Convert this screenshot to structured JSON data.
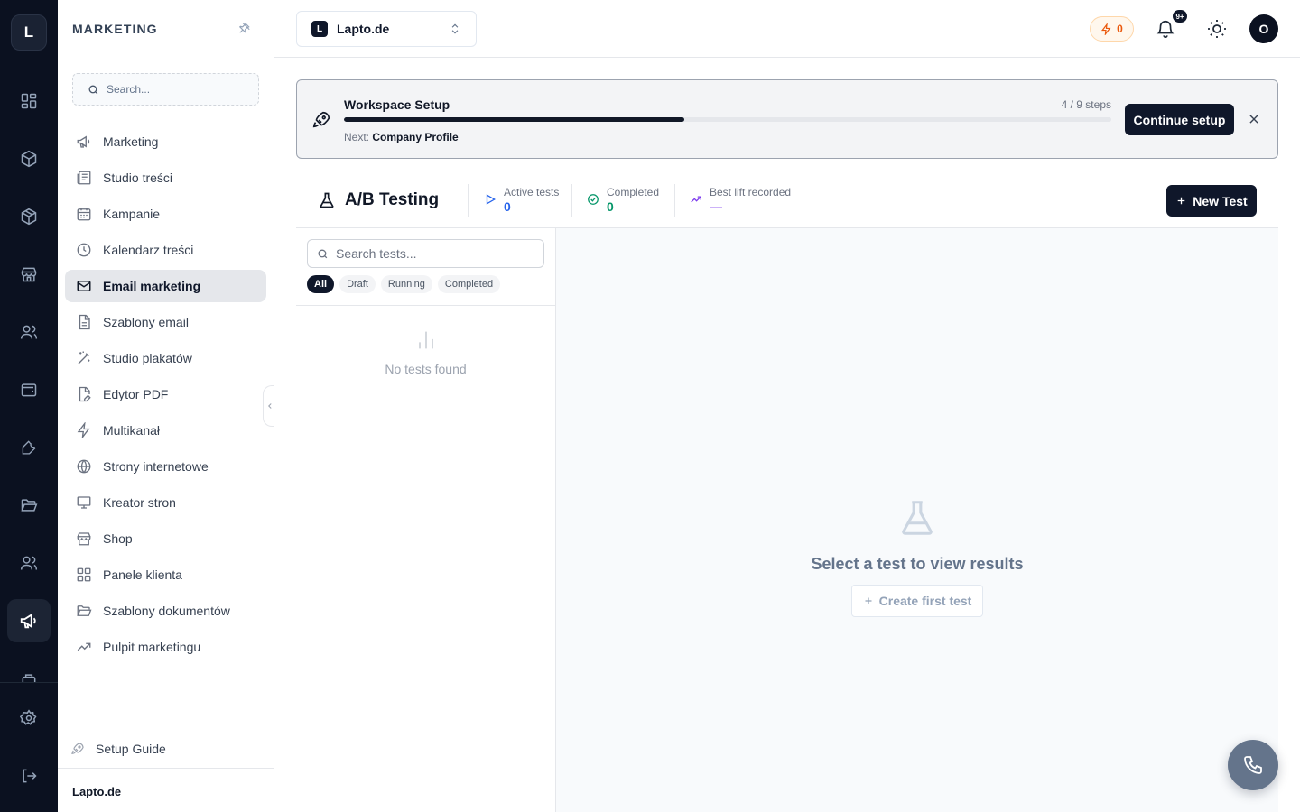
{
  "rail": {
    "logo": "L",
    "items": [
      {
        "icon": "layout-grid-icon"
      },
      {
        "icon": "box-icon"
      },
      {
        "icon": "package-icon"
      },
      {
        "icon": "store-icon"
      },
      {
        "icon": "users-icon"
      },
      {
        "icon": "wallet-icon"
      },
      {
        "icon": "wrench-icon"
      },
      {
        "icon": "folder-open-icon"
      },
      {
        "icon": "user-group-icon"
      },
      {
        "icon": "megaphone-icon",
        "active": true
      }
    ],
    "bottom": [
      {
        "icon": "gear-icon"
      },
      {
        "icon": "logout-icon"
      }
    ]
  },
  "sidebar": {
    "title": "MARKETING",
    "search_placeholder": "Search...",
    "items": [
      {
        "label": "Marketing",
        "icon": "megaphone-icon"
      },
      {
        "label": "Studio treści",
        "icon": "newspaper-icon"
      },
      {
        "label": "Kampanie",
        "icon": "calendar-icon"
      },
      {
        "label": "Kalendarz treści",
        "icon": "clock-icon"
      },
      {
        "label": "Email marketing",
        "icon": "mail-icon",
        "active": true
      },
      {
        "label": "Szablony email",
        "icon": "file-text-icon"
      },
      {
        "label": "Studio plakatów",
        "icon": "wand-icon"
      },
      {
        "label": "Edytor PDF",
        "icon": "file-pen-icon"
      },
      {
        "label": "Multikanał",
        "icon": "zap-icon"
      },
      {
        "label": "Strony internetowe",
        "icon": "globe-icon"
      },
      {
        "label": "Kreator stron",
        "icon": "monitor-icon"
      },
      {
        "label": "Shop",
        "icon": "store-icon"
      },
      {
        "label": "Panele klienta",
        "icon": "layout-grid-icon"
      },
      {
        "label": "Szablony dokumentów",
        "icon": "folder-icon"
      },
      {
        "label": "Pulpit marketingu",
        "icon": "trending-up-icon"
      }
    ],
    "setup_guide": "Setup Guide",
    "footer_name": "Lapto.de"
  },
  "header": {
    "workspace_badge": "L",
    "workspace_name": "Lapto.de",
    "credits": "0",
    "notifications_badge": "9+",
    "avatar": "O"
  },
  "setup_banner": {
    "title": "Workspace Setup",
    "steps_text": "4 / 9 steps",
    "progress": 0.444,
    "next_label": "Next:",
    "next_value": "Company Profile",
    "button": "Continue setup"
  },
  "ab": {
    "title": "A/B Testing",
    "stats": [
      {
        "label": "Active tests",
        "value": "0",
        "color": "#2563eb",
        "icon": "play-icon"
      },
      {
        "label": "Completed",
        "value": "0",
        "color": "#059669",
        "icon": "check-circle-icon"
      },
      {
        "label": "Best lift recorded",
        "value": "—",
        "color": "#7c3aed",
        "icon": "trending-up-icon"
      }
    ],
    "new_button": "New Test",
    "search_placeholder": "Search tests...",
    "filters": [
      "All",
      "Draft",
      "Running",
      "Completed"
    ],
    "active_filter": "All",
    "empty_list": "No tests found",
    "detail_empty": "Select a test to view results",
    "create_first": "Create first test"
  },
  "colors": {
    "rail_bg": "#0b1120",
    "primary": "#0f172a",
    "credits": "#ea580c"
  }
}
